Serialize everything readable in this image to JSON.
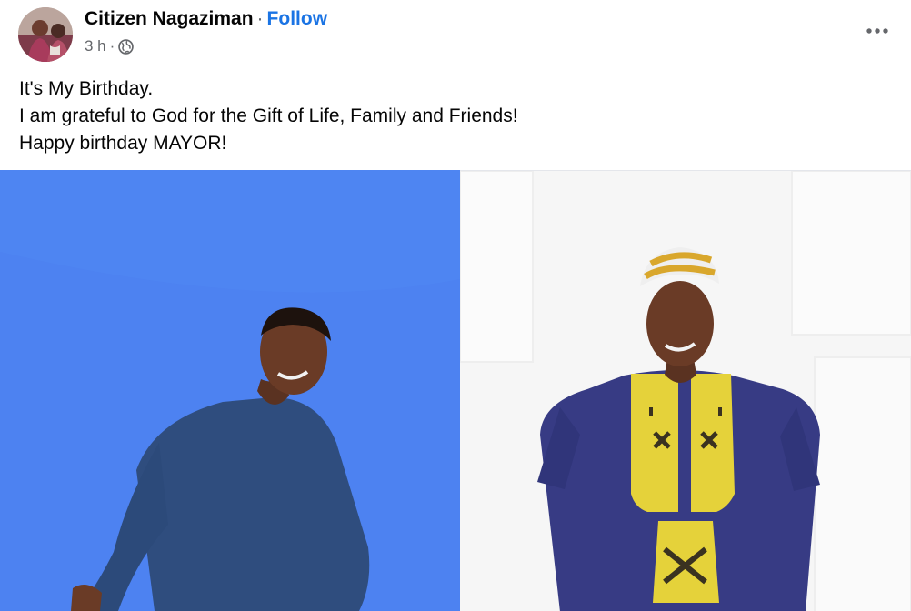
{
  "post": {
    "author": "Citizen Nagaziman",
    "separator": "·",
    "follow_label": "Follow",
    "time": "3 h",
    "meta_separator": "·",
    "audience_icon": "globe-icon",
    "more_icon": "more-options-icon",
    "caption_lines": [
      "It's My Birthday.",
      "I am grateful to God for the Gift of Life, Family and Friends!",
      "Happy birthday MAYOR!"
    ]
  },
  "colors": {
    "link": "#1b74e4",
    "secondary_text": "#65676b",
    "left_photo_background": "#4d82f1",
    "right_photo_background": "#f6f6f6"
  }
}
